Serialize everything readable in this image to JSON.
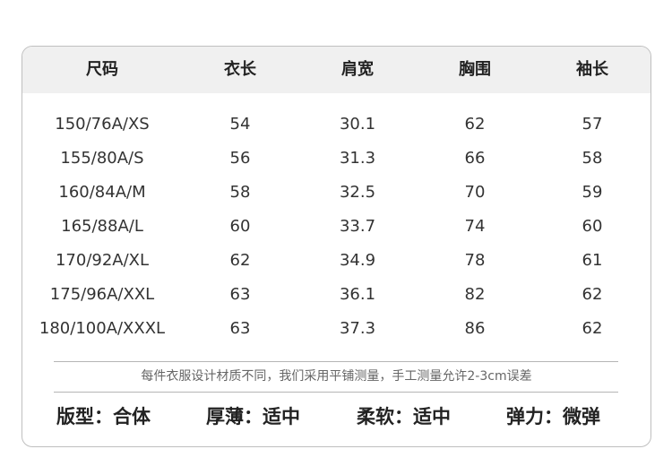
{
  "table": {
    "headers": [
      "尺码",
      "衣长",
      "肩宽",
      "胸围",
      "袖长"
    ],
    "rows": [
      [
        "150/76A/XS",
        "54",
        "30.1",
        "62",
        "57"
      ],
      [
        "155/80A/S",
        "56",
        "31.3",
        "66",
        "58"
      ],
      [
        "160/84A/M",
        "58",
        "32.5",
        "70",
        "59"
      ],
      [
        "165/88A/L",
        "60",
        "33.7",
        "74",
        "60"
      ],
      [
        "170/92A/XL",
        "62",
        "34.9",
        "78",
        "61"
      ],
      [
        "175/96A/XXL",
        "63",
        "36.1",
        "82",
        "62"
      ],
      [
        "180/100A/XXXL",
        "63",
        "37.3",
        "86",
        "62"
      ]
    ]
  },
  "note": "每件衣服设计材质不同，我们采用平铺测量，手工测量允许2-3cm误差",
  "attributes": [
    {
      "label": "版型：",
      "value": "合体"
    },
    {
      "label": "厚薄：",
      "value": "适中"
    },
    {
      "label": "柔软：",
      "value": "适中"
    },
    {
      "label": "弹力：",
      "value": "微弹"
    }
  ]
}
